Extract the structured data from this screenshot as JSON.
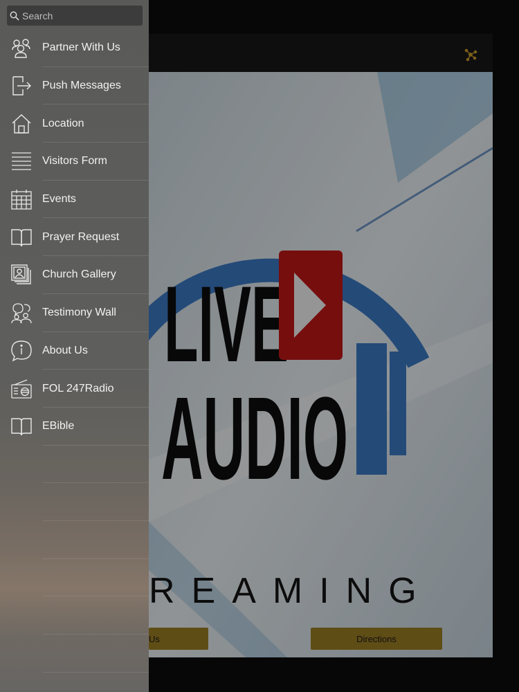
{
  "search": {
    "placeholder": "Search"
  },
  "menu": {
    "items": [
      {
        "label": "Partner With Us",
        "icon": "people-group-icon"
      },
      {
        "label": "Push Messages",
        "icon": "sign-in-icon"
      },
      {
        "label": "Location",
        "icon": "home-icon"
      },
      {
        "label": "Visitors Form",
        "icon": "lines-list-icon"
      },
      {
        "label": "Events",
        "icon": "calendar-icon"
      },
      {
        "label": "Prayer Request",
        "icon": "book-icon"
      },
      {
        "label": "Church Gallery",
        "icon": "photo-album-icon"
      },
      {
        "label": "Testimony Wall",
        "icon": "people-chat-icon"
      },
      {
        "label": "About Us",
        "icon": "info-bubble-icon"
      },
      {
        "label": "FOL 247Radio",
        "icon": "radio-icon"
      },
      {
        "label": "EBible",
        "icon": "book-icon"
      }
    ]
  },
  "background_app": {
    "hero": {
      "line1": "LIVE",
      "line2": "AUDIO",
      "line3": "REAMING"
    },
    "buttons": {
      "partial_label": "Us",
      "directions_label": "Directions"
    },
    "share_icon": "share-nodes-icon"
  },
  "colors": {
    "drawer_bg": "#5c5c5a",
    "accent_gold": "#9a7d24",
    "play_red": "#c01818",
    "headphone_blue": "#3a78c2"
  }
}
